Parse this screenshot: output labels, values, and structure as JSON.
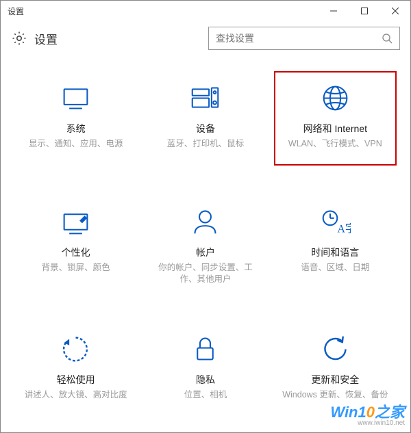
{
  "window": {
    "title": "设置"
  },
  "header": {
    "title": "设置"
  },
  "search": {
    "placeholder": "查找设置"
  },
  "tiles": [
    {
      "title": "系统",
      "desc": "显示、通知、应用、电源"
    },
    {
      "title": "设备",
      "desc": "蓝牙、打印机、鼠标"
    },
    {
      "title": "网络和 Internet",
      "desc": "WLAN、飞行模式、VPN"
    },
    {
      "title": "个性化",
      "desc": "背景、锁屏、颜色"
    },
    {
      "title": "帐户",
      "desc": "你的帐户、同步设置、工作、其他用户"
    },
    {
      "title": "时间和语言",
      "desc": "语音、区域、日期"
    },
    {
      "title": "轻松使用",
      "desc": "讲述人、放大镜、高对比度"
    },
    {
      "title": "隐私",
      "desc": "位置、相机"
    },
    {
      "title": "更新和安全",
      "desc": "Windows 更新、恢复、备份"
    }
  ],
  "watermark": {
    "text": "Win10之家",
    "url": "www.iwin10.net"
  }
}
